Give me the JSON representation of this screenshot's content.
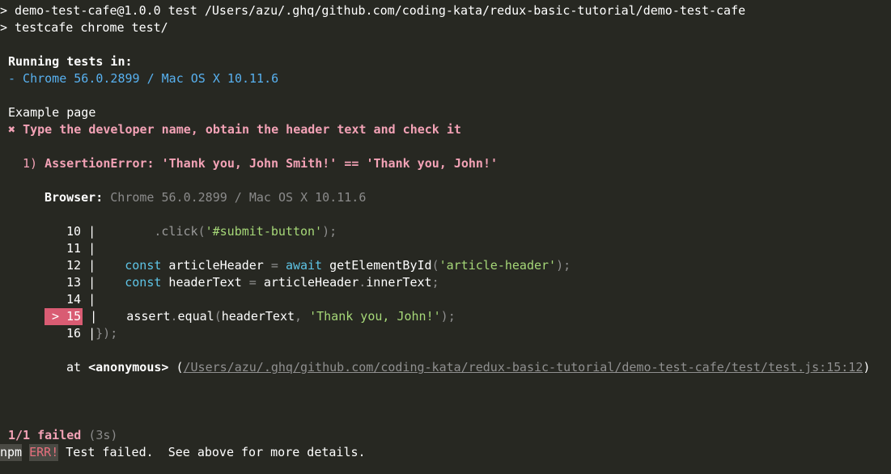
{
  "header": {
    "line1": "> demo-test-cafe@1.0.0 test /Users/azu/.ghq/github.com/coding-kata/redux-basic-tutorial/demo-test-cafe",
    "line2": "> testcafe chrome test/"
  },
  "running": {
    "title": "Running tests in:",
    "browser": "- Chrome 56.0.2899 / Mac OS X 10.11.6"
  },
  "fixture": {
    "name": "Example page",
    "test_fail_symbol": "✖",
    "test_name": "Type the developer name, obtain the header text and check it"
  },
  "error": {
    "index": "1)",
    "message": "AssertionError: 'Thank you, John Smith!' == 'Thank you, John!'",
    "browser_label": "Browser:",
    "browser_value": "Chrome 56.0.2899 / Mac OS X 10.11.6"
  },
  "code": {
    "lines": [
      {
        "num": "10",
        "sep": "|",
        "text": "        .click('#submit-button');"
      },
      {
        "num": "11",
        "sep": "|",
        "text": ""
      },
      {
        "num": "12",
        "sep": "|",
        "text": "    const articleHeader = await getElementById('article-header');"
      },
      {
        "num": "13",
        "sep": "|",
        "text": "    const headerText = articleHeader.innerText;"
      },
      {
        "num": "14",
        "sep": "|",
        "text": ""
      },
      {
        "num": "> 15",
        "sep": "|",
        "text": "    assert.equal(headerText, 'Thank you, John!');"
      },
      {
        "num": "16",
        "sep": "|",
        "text": "});"
      }
    ]
  },
  "stack": {
    "at": "at",
    "fn": "<anonymous>",
    "open_paren": "(",
    "path": "/Users/azu/.ghq/github.com/coding-kata/redux-basic-tutorial/demo-test-cafe/test/test.js:15:12",
    "close_paren": ")"
  },
  "summary": {
    "failed": "1/1 failed",
    "duration": "(3s)"
  },
  "npm": {
    "prefix": "npm",
    "err": "ERR!",
    "message": " Test failed.  See above for more details."
  },
  "colors": {
    "background": "#272822",
    "error_pink": "#f3a2b6",
    "browser_blue": "#58b1f0",
    "marker_red": "#d95c73"
  }
}
